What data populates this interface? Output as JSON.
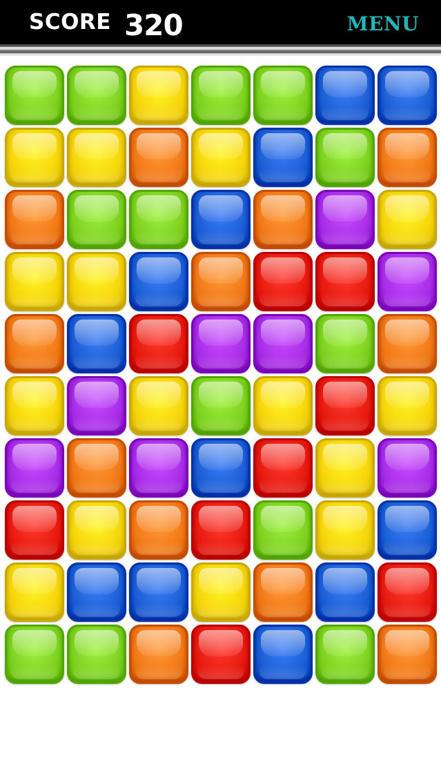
{
  "header": {
    "score_label": "SCORE",
    "score_value": "320",
    "menu_label": "MENU"
  },
  "palette": {
    "green": "#7fd320",
    "yellow": "#f6d60a",
    "orange": "#f27a18",
    "blue": "#1d5fd6",
    "red": "#e81b10",
    "purple": "#a92ee8"
  },
  "board": {
    "columns": 7,
    "rows": 10,
    "tiles": [
      [
        "green",
        "green",
        "yellow",
        "green",
        "green",
        "blue",
        "blue"
      ],
      [
        "yellow",
        "yellow",
        "orange",
        "yellow",
        "blue",
        "green",
        "orange"
      ],
      [
        "orange",
        "green",
        "green",
        "blue",
        "orange",
        "purple",
        "yellow"
      ],
      [
        "yellow",
        "yellow",
        "blue",
        "orange",
        "red",
        "red",
        "purple"
      ],
      [
        "orange",
        "blue",
        "red",
        "purple",
        "purple",
        "green",
        "orange"
      ],
      [
        "yellow",
        "purple",
        "yellow",
        "green",
        "yellow",
        "red",
        "yellow"
      ],
      [
        "purple",
        "orange",
        "purple",
        "blue",
        "red",
        "yellow",
        "purple"
      ],
      [
        "red",
        "yellow",
        "orange",
        "red",
        "green",
        "yellow",
        "blue"
      ],
      [
        "yellow",
        "blue",
        "blue",
        "yellow",
        "orange",
        "blue",
        "red"
      ],
      [
        "green",
        "green",
        "orange",
        "red",
        "blue",
        "green",
        "orange"
      ]
    ]
  }
}
